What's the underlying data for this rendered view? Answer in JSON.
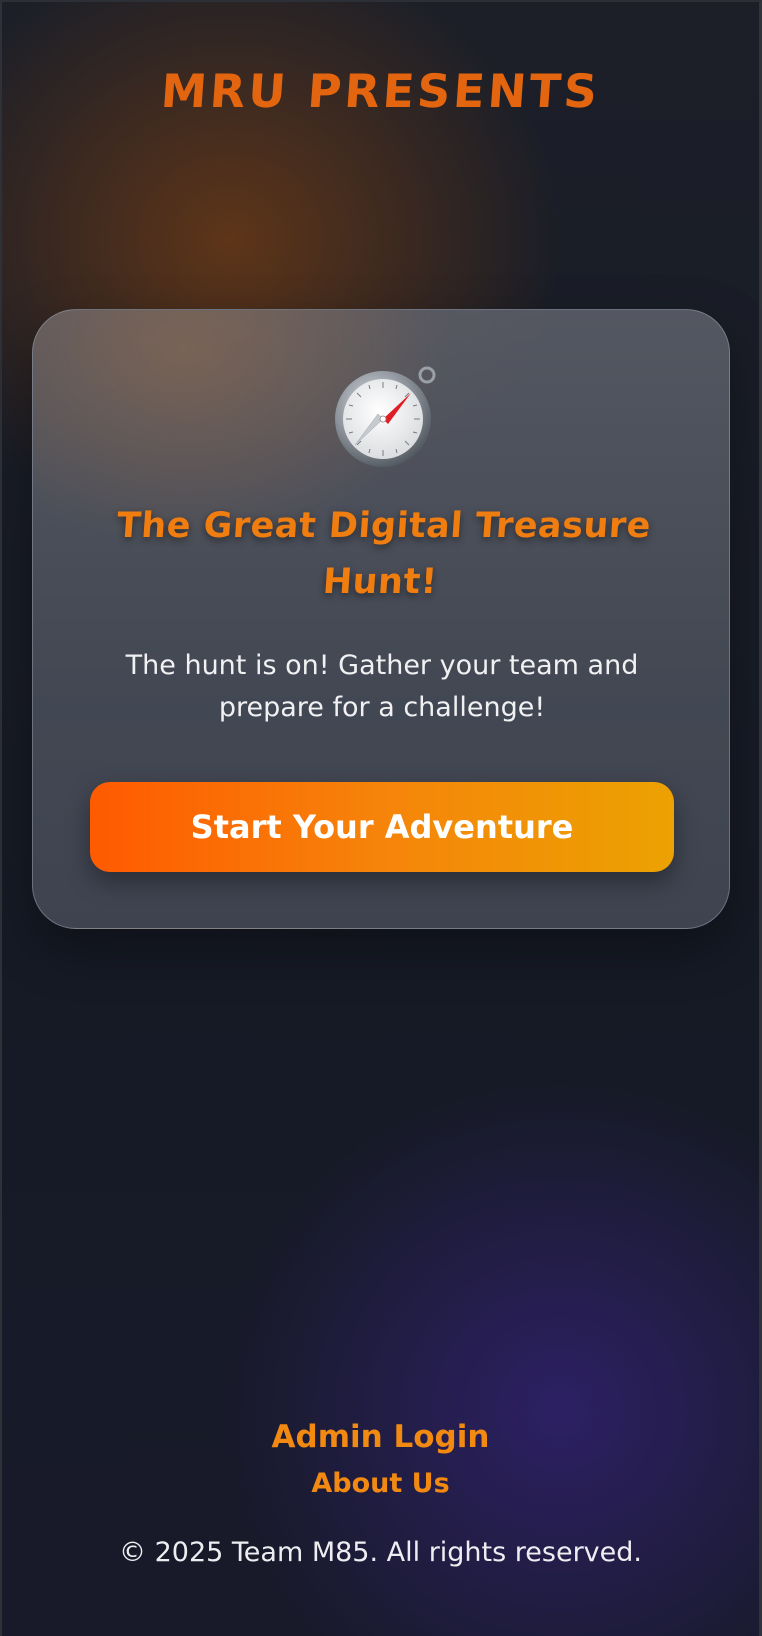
{
  "header": {
    "brand": "MRU PRESENTS"
  },
  "hero": {
    "icon": "compass-icon",
    "title": "The Great Digital Treasure Hunt!",
    "description": "The hunt is on! Gather your team and prepare for a challenge!",
    "cta_label": "Start Your Adventure"
  },
  "footer": {
    "admin_login": "Admin Login",
    "about_us": "About Us",
    "copyright": "© 2025 Team M85. All rights reserved."
  },
  "colors": {
    "accent": "#f07d10",
    "button_start": "#ff5a00",
    "button_end": "#eba202",
    "background": "#181c27"
  }
}
